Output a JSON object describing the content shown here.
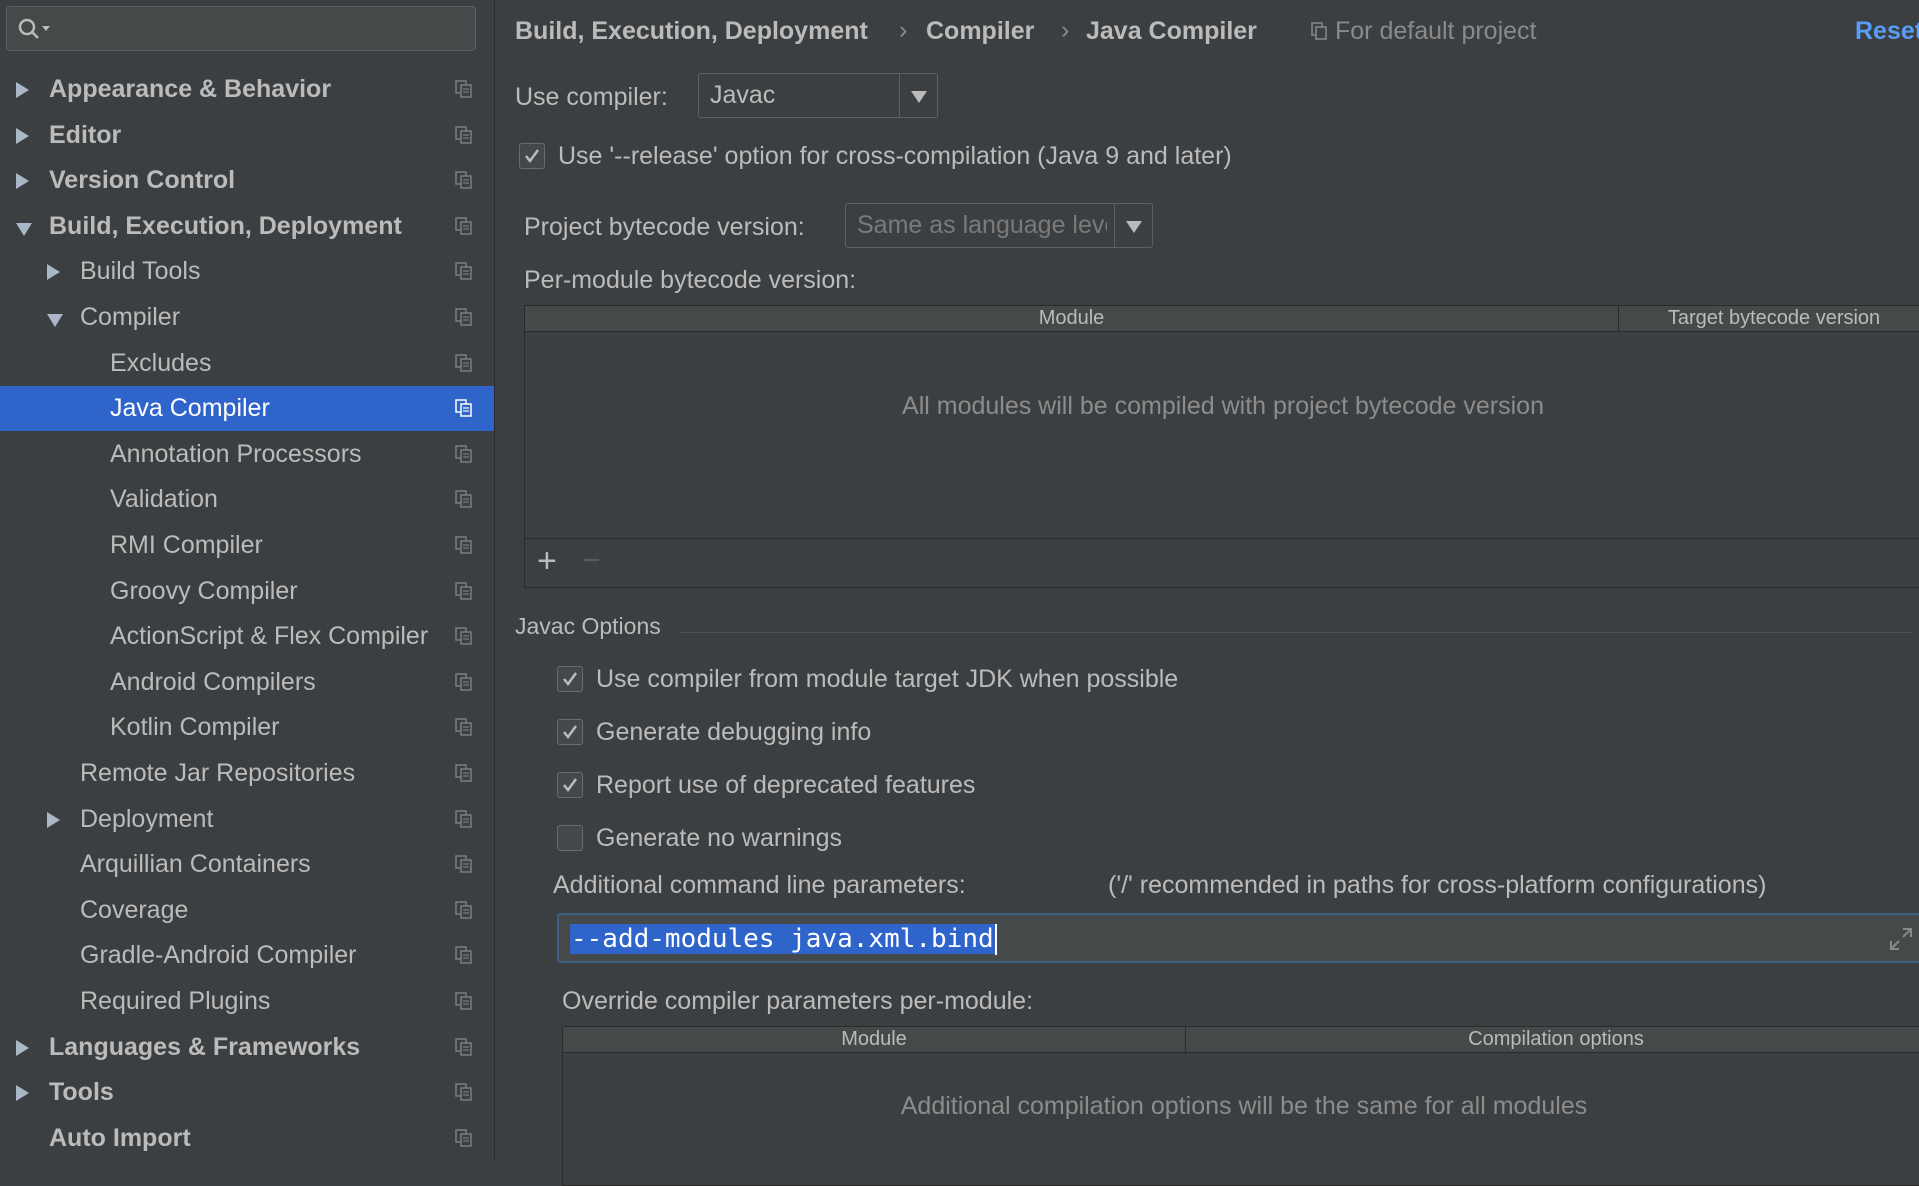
{
  "search": {
    "placeholder": ""
  },
  "sidebar": {
    "items": [
      {
        "label": "Appearance & Behavior",
        "level": 0,
        "arrow": "right",
        "bold": true
      },
      {
        "label": "Editor",
        "level": 0,
        "arrow": "right",
        "bold": true
      },
      {
        "label": "Version Control",
        "level": 0,
        "arrow": "right",
        "bold": true
      },
      {
        "label": "Build, Execution, Deployment",
        "level": 0,
        "arrow": "down",
        "bold": true
      },
      {
        "label": "Build Tools",
        "level": 1,
        "arrow": "right",
        "bold": false
      },
      {
        "label": "Compiler",
        "level": 1,
        "arrow": "down",
        "bold": false
      },
      {
        "label": "Excludes",
        "level": 2,
        "arrow": "none",
        "bold": false
      },
      {
        "label": "Java Compiler",
        "level": 2,
        "arrow": "none",
        "bold": false,
        "selected": true
      },
      {
        "label": "Annotation Processors",
        "level": 2,
        "arrow": "none",
        "bold": false
      },
      {
        "label": "Validation",
        "level": 2,
        "arrow": "none",
        "bold": false
      },
      {
        "label": "RMI Compiler",
        "level": 2,
        "arrow": "none",
        "bold": false
      },
      {
        "label": "Groovy Compiler",
        "level": 2,
        "arrow": "none",
        "bold": false
      },
      {
        "label": "ActionScript & Flex Compiler",
        "level": 2,
        "arrow": "none",
        "bold": false
      },
      {
        "label": "Android Compilers",
        "level": 2,
        "arrow": "none",
        "bold": false
      },
      {
        "label": "Kotlin Compiler",
        "level": 2,
        "arrow": "none",
        "bold": false
      },
      {
        "label": "Remote Jar Repositories",
        "level": 1,
        "arrow": "none",
        "bold": false
      },
      {
        "label": "Deployment",
        "level": 1,
        "arrow": "right",
        "bold": false
      },
      {
        "label": "Arquillian Containers",
        "level": 1,
        "arrow": "none",
        "bold": false
      },
      {
        "label": "Coverage",
        "level": 1,
        "arrow": "none",
        "bold": false
      },
      {
        "label": "Gradle-Android Compiler",
        "level": 1,
        "arrow": "none",
        "bold": false
      },
      {
        "label": "Required Plugins",
        "level": 1,
        "arrow": "none",
        "bold": false
      },
      {
        "label": "Languages & Frameworks",
        "level": 0,
        "arrow": "right",
        "bold": true
      },
      {
        "label": "Tools",
        "level": 0,
        "arrow": "right",
        "bold": true
      },
      {
        "label": "Auto Import",
        "level": 0,
        "arrow": "none",
        "bold": true
      }
    ]
  },
  "header": {
    "breadcrumbs": [
      "Build, Execution, Deployment",
      "Compiler",
      "Java Compiler"
    ],
    "separator": "›",
    "scope": "For default project",
    "reset": "Reset"
  },
  "compiler": {
    "use_label": "Use compiler:",
    "use_value": "Javac",
    "release_option": {
      "label": "Use '--release' option for cross-compilation (Java 9 and later)",
      "checked": true
    },
    "bytecode_label": "Project bytecode version:",
    "bytecode_value": "Same as language level",
    "per_module_label": "Per-module bytecode version:",
    "module_table": {
      "columns": [
        "Module",
        "Target bytecode version"
      ],
      "empty_text": "All modules will be compiled with project bytecode version",
      "add": "+",
      "remove": "−"
    }
  },
  "javac": {
    "section_title": "Javac Options",
    "options": [
      {
        "label": "Use compiler from module target JDK when possible",
        "checked": true
      },
      {
        "label": "Generate debugging info",
        "checked": true
      },
      {
        "label": "Report use of deprecated features",
        "checked": true
      },
      {
        "label": "Generate no warnings",
        "checked": false
      }
    ],
    "cmd_label": "Additional command line parameters:",
    "cmd_hint": "('/' recommended in paths for cross-platform configurations)",
    "cmd_value": "--add-modules java.xml.bind",
    "override_label": "Override compiler parameters per-module:",
    "override_table": {
      "columns": [
        "Module",
        "Compilation options"
      ],
      "empty_text": "Additional compilation options will be the same for all modules"
    }
  },
  "colors": {
    "background": "#3c3f41",
    "selection": "#2f65ca",
    "link": "#589df6",
    "text": "#bbbbbb"
  }
}
